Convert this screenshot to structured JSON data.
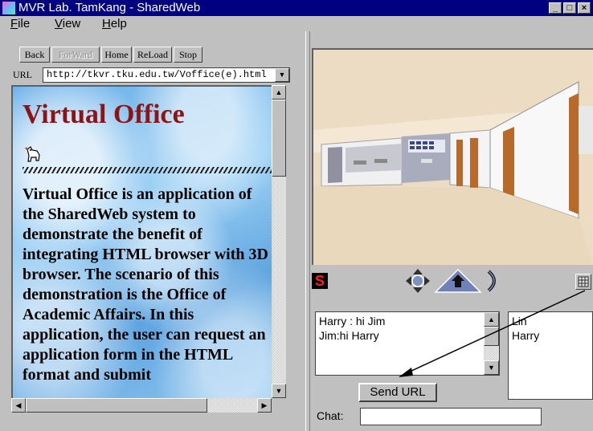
{
  "window": {
    "title": "MVR Lab. TamKang - SharedWeb",
    "min": "_",
    "max": "□",
    "close": "×"
  },
  "menu": [
    {
      "mnemonic": "F",
      "rest": "ile"
    },
    {
      "mnemonic": "V",
      "rest": "iew"
    },
    {
      "mnemonic": "H",
      "rest": "elp"
    }
  ],
  "nav": {
    "back": "Back",
    "forward": "ForWard",
    "home": "Home",
    "reload": "ReLoad",
    "stop": "Stop"
  },
  "url": {
    "label": "URL",
    "value": "http://tkvr.tku.edu.tw/Voffice(e).html"
  },
  "page": {
    "title": "Virtual Office",
    "body": "Virtual Office is an application of the SharedWeb system to demonstrate the benefit of integrating HTML browser with 3D browser. The scenario of this demonstration is the Office of Academic Affairs. In this application, the user can request an application form in the HTML format and submit"
  },
  "logo_letter": "S",
  "chat": {
    "messages": [
      "Harry : hi Jim",
      "Jim:hi Harry"
    ],
    "users": [
      "Lin",
      "Harry"
    ],
    "send_label": "Send URL",
    "input_label": "Chat:",
    "input_value": ""
  },
  "colors": {
    "title_bar": "#000080",
    "doc_title": "#8b1515",
    "logo_red": "#ff2020"
  }
}
